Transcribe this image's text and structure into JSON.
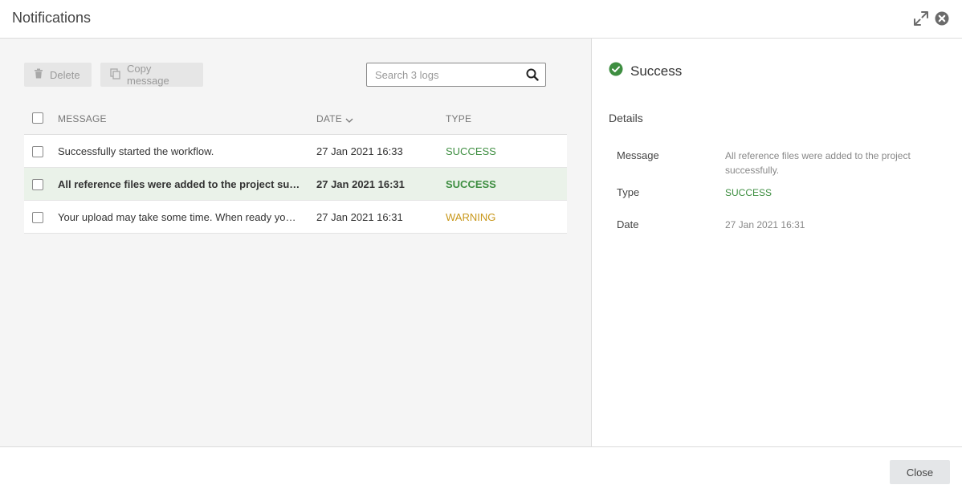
{
  "window": {
    "title": "Notifications"
  },
  "toolbar": {
    "delete_label": "Delete",
    "copy_label": "Copy message"
  },
  "search": {
    "placeholder": "Search 3 logs"
  },
  "table": {
    "headers": {
      "message": "MESSAGE",
      "date": "DATE",
      "type": "TYPE"
    },
    "sort": "DATE descending",
    "rows": [
      {
        "message": "Successfully started the workflow.",
        "date": "27 Jan 2021 16:33",
        "type": "SUCCESS",
        "selected": false
      },
      {
        "message": "All reference files were added to the project succe...",
        "date": "27 Jan 2021 16:31",
        "type": "SUCCESS",
        "selected": true
      },
      {
        "message": "Your upload may take some time. When ready you ...",
        "date": "27 Jan 2021 16:31",
        "type": "WARNING",
        "selected": false
      }
    ]
  },
  "detail": {
    "status_label": "Success",
    "section_title": "Details",
    "message_label": "Message",
    "message_value": "All reference files were added to the project successfully.",
    "type_label": "Type",
    "type_value": "SUCCESS",
    "date_label": "Date",
    "date_value": "27 Jan 2021 16:31"
  },
  "footer": {
    "close_label": "Close"
  },
  "colors": {
    "success": "#3e8e41",
    "warning": "#c8971a",
    "selected_row": "#eaf2e9",
    "panel_bg": "#f5f5f5"
  },
  "icons": {
    "expand": "expand-icon",
    "close": "close-circle-icon",
    "delete": "trash-icon",
    "copy": "copy-icon",
    "search": "search-icon",
    "status": "check-circle-icon",
    "sort": "chevron-down-icon"
  }
}
